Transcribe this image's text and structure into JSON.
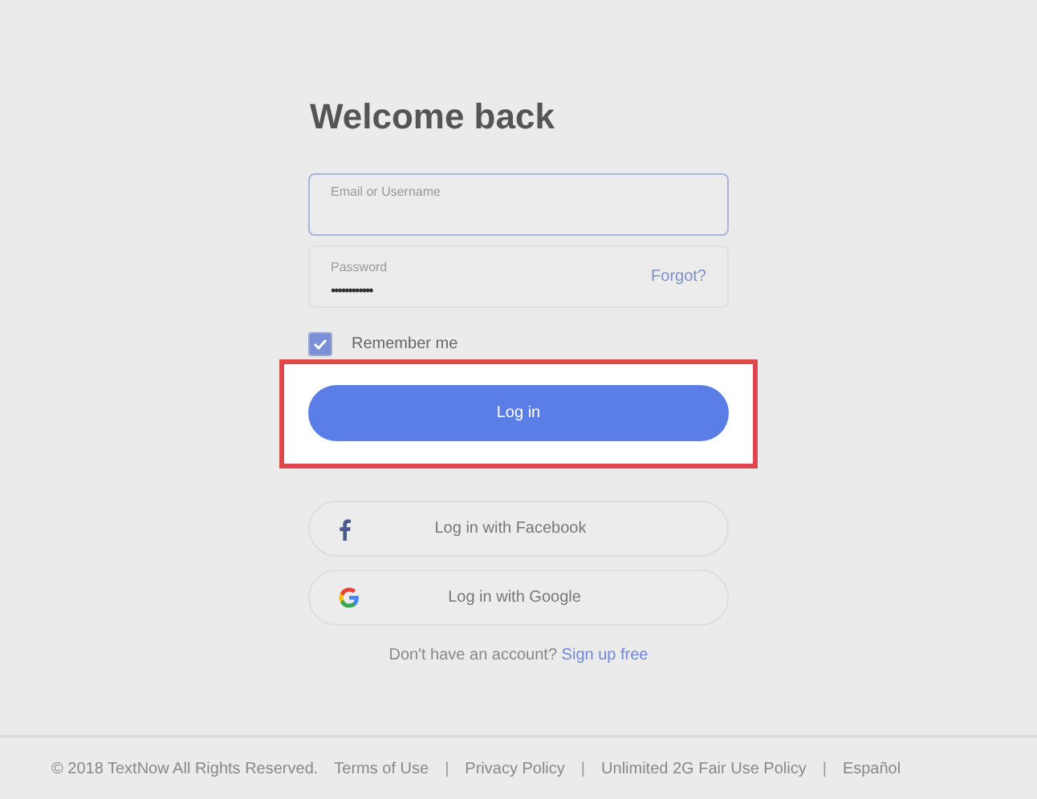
{
  "title": "Welcome back",
  "email_field": {
    "placeholder": "Email or Username",
    "focused": true
  },
  "password_field": {
    "label": "Password",
    "value": "••••••••••••",
    "forgot": "Forgot?"
  },
  "remember": {
    "label": "Remember me",
    "checked": true
  },
  "login_button": {
    "label": "Log in",
    "highlighted": true
  },
  "social_buttons": [
    {
      "kind": "facebook",
      "label": "Log in with Facebook"
    },
    {
      "kind": "google",
      "label": "Log in with Google"
    }
  ],
  "signup": {
    "text": "Don't have an account?",
    "link": "Sign up free"
  },
  "footer": {
    "copyright": "© 2018 TextNow All Rights Reserved.",
    "links": [
      "Terms of Use",
      "Privacy Policy",
      "Unlimited 2G Fair Use Policy",
      "Español"
    ],
    "separator": "|"
  }
}
